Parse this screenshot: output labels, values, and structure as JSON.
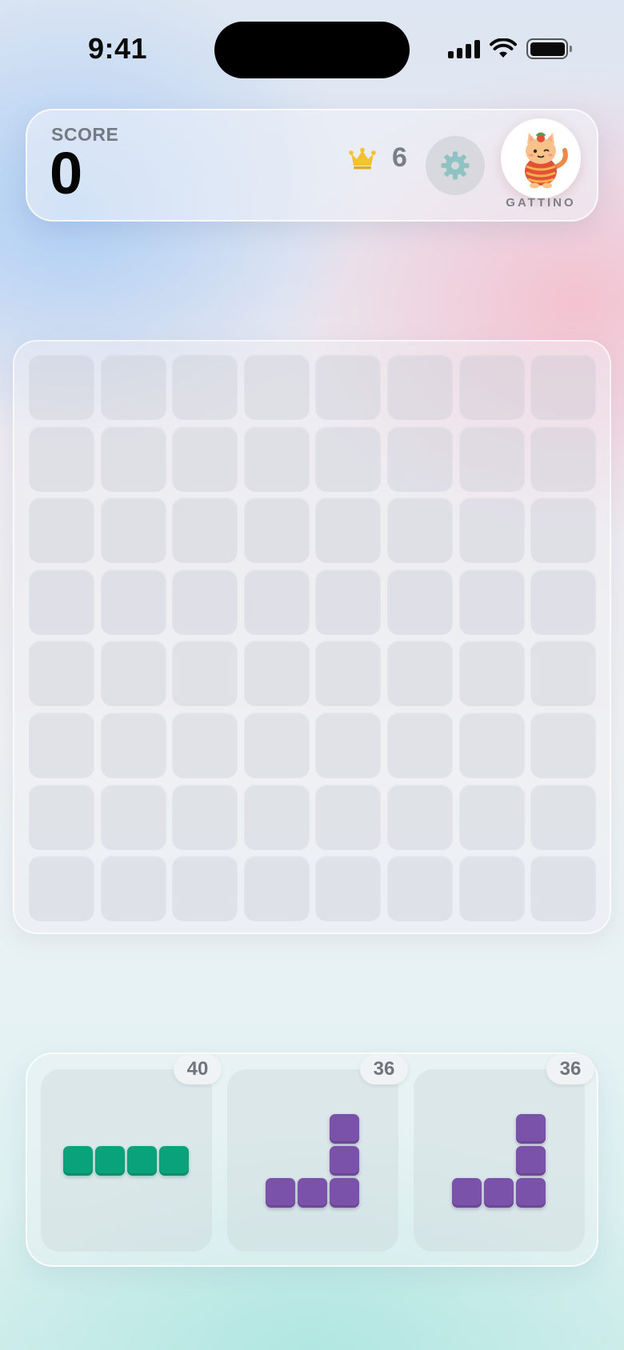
{
  "status_bar": {
    "time": "9:41"
  },
  "score_card": {
    "score_label": "SCORE",
    "score_value": "0",
    "best_value": "6",
    "avatar_name": "GATTINO"
  },
  "board": {
    "rows": 8,
    "cols": 8,
    "filled_cells": 0
  },
  "tray": {
    "pieces": [
      {
        "value": "40",
        "color": "#0aa27a",
        "shape": "I4-horizontal"
      },
      {
        "value": "36",
        "color": "#7b52a9",
        "shape": "J-bottom-right"
      },
      {
        "value": "36",
        "color": "#7b52a9",
        "shape": "J-bottom-right"
      }
    ]
  },
  "colors": {
    "green_block": "#0aa27a",
    "purple_block": "#7b52a9",
    "crown": "#f2c230",
    "gear": "#8fc3c3"
  }
}
